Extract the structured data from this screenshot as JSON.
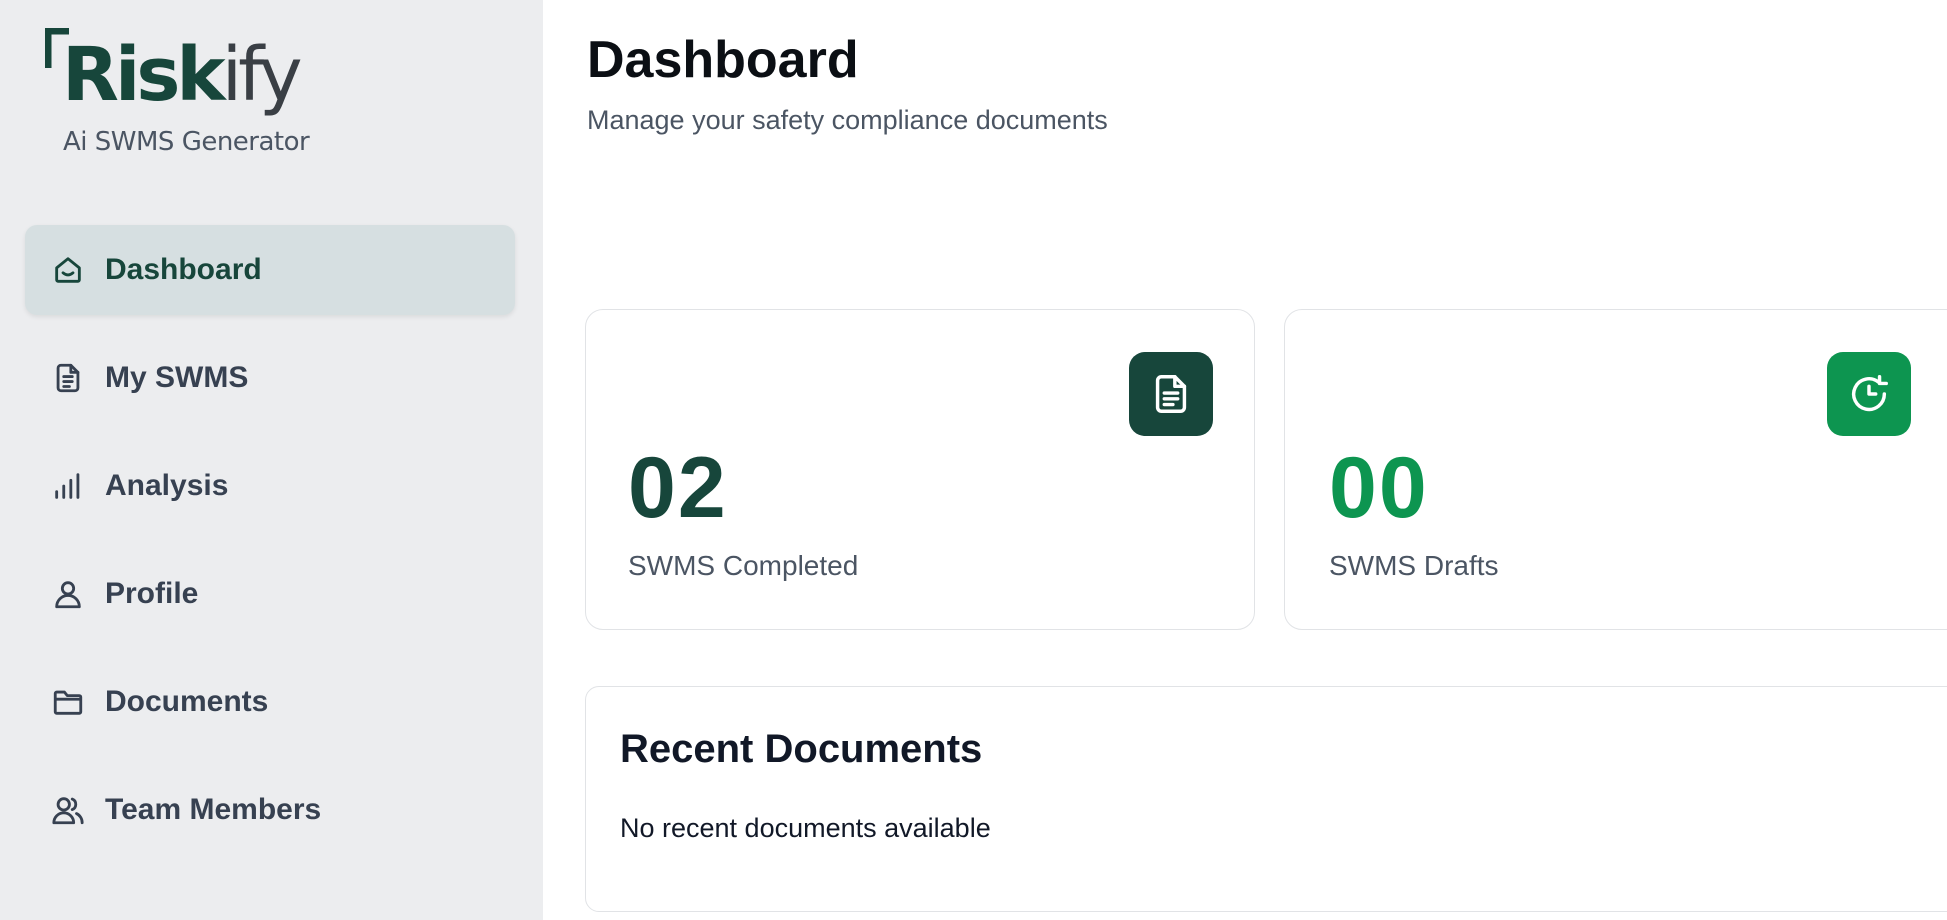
{
  "brand": {
    "name_main": "Risk",
    "name_tail": "ify",
    "tagline": "Ai SWMS Generator",
    "colors": {
      "primary": "#17463b",
      "accent": "#0d9550",
      "sidebar_bg": "#ecedef"
    }
  },
  "sidebar": {
    "items": [
      {
        "label": "Dashboard",
        "icon": "home-icon",
        "active": true
      },
      {
        "label": "My SWMS",
        "icon": "document-icon",
        "active": false
      },
      {
        "label": "Analysis",
        "icon": "bar-chart-icon",
        "active": false
      },
      {
        "label": "Profile",
        "icon": "user-icon",
        "active": false
      },
      {
        "label": "Documents",
        "icon": "folder-icon",
        "active": false
      },
      {
        "label": "Team Members",
        "icon": "users-icon",
        "active": false
      }
    ]
  },
  "header": {
    "title": "Dashboard",
    "subtitle": "Manage your safety compliance documents"
  },
  "stats": [
    {
      "value": "02",
      "label": "SWMS Completed",
      "icon": "document-icon"
    },
    {
      "value": "00",
      "label": "SWMS Drafts",
      "icon": "clock-refresh-icon"
    }
  ],
  "recent": {
    "title": "Recent Documents",
    "empty_message": "No recent documents available"
  }
}
